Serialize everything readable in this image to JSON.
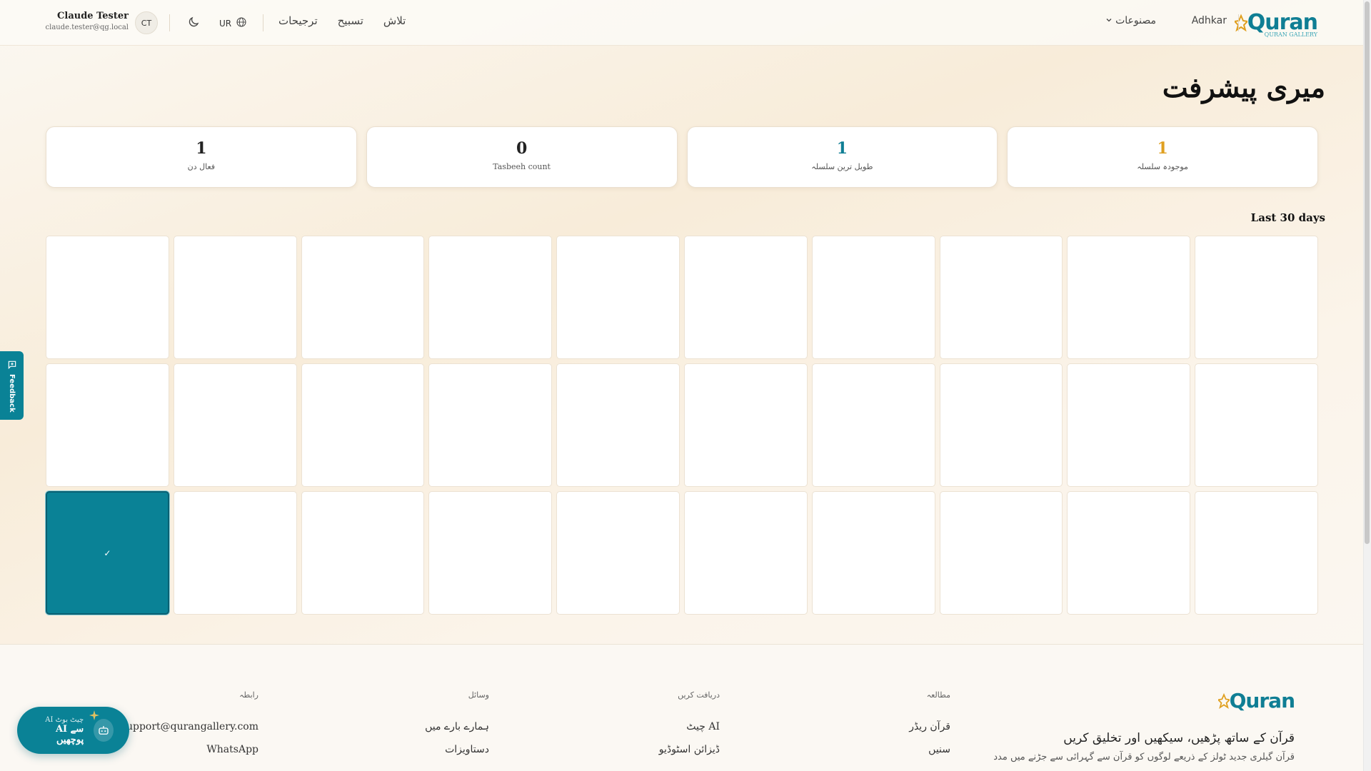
{
  "header": {
    "logo_text": "Quran",
    "logo_sub": "QURAN GALLERY",
    "nav_adhkar": "Adhkar",
    "nav_products": "مصنوعات",
    "nav_links": [
      "تلاش",
      "تسبیح",
      "ترجیحات"
    ],
    "language": "UR",
    "user": {
      "initials": "CT",
      "name": "Claude Tester",
      "email": "claude.tester@qg.local"
    }
  },
  "page": {
    "title": "میری پیشرفت"
  },
  "stats": [
    {
      "value": "1",
      "label": "موجودہ سلسلہ",
      "color": "#e0a020"
    },
    {
      "value": "1",
      "label": "طویل ترین سلسلہ",
      "color": "#0f7e94"
    },
    {
      "value": "0",
      "label": "Tasbeeh count",
      "color": "#222222"
    },
    {
      "value": "1",
      "label": "فعال دن",
      "color": "#222222"
    }
  ],
  "calendar": {
    "label": "Last 30 days",
    "active_mark": "✓",
    "active_index": 20,
    "total_days": 30
  },
  "footer": {
    "logo_text": "Quran",
    "logo_sub": "QURAN GALLERY",
    "tagline": "قرآن کے ساتھ پڑھیں، سیکھیں اور تخلیق کریں",
    "description": "قرآن گیلری جدید ٹولز کے ذریعے لوگوں کو قرآن سے گہرائی سے جڑنے میں مدد",
    "columns": [
      {
        "heading": "مطالعہ",
        "items": [
          "قرآن ریڈر",
          "سنیں"
        ]
      },
      {
        "heading": "دریافت کریں",
        "items": [
          "AI چیٹ",
          "ڈیزائن اسٹوڈیو"
        ]
      },
      {
        "heading": "وسائل",
        "items": [
          "ہمارے بارے میں",
          "دستاویزات"
        ]
      },
      {
        "heading": "رابطہ",
        "items": [
          "support@qurangallery.com",
          "WhatsApp"
        ]
      }
    ]
  },
  "floating": {
    "feedback": "Feedback",
    "ai_small": "AI چیٹ بوٹ",
    "ai_main": "AI سے پوچھیں"
  },
  "colors": {
    "accent": "#0a8296",
    "gold": "#e0a020",
    "brand": "#0f7e94"
  }
}
